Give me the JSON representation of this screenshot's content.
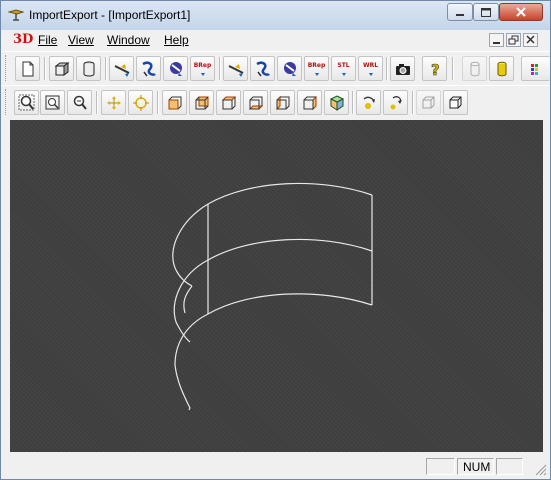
{
  "window": {
    "title": "ImportExport - [ImportExport1]"
  },
  "menubar": {
    "logo": "3D",
    "items": [
      {
        "id": "file",
        "label": "File"
      },
      {
        "id": "view",
        "label": "View"
      },
      {
        "id": "window",
        "label": "Window"
      },
      {
        "id": "help",
        "label": "Help"
      }
    ]
  },
  "toolbar1": {
    "buttons": [
      {
        "name": "new-document-button",
        "icon": "page-icon"
      },
      {
        "name": "open-box-button",
        "icon": "box-icon"
      },
      {
        "name": "open-cylinder-button",
        "icon": "cylinder-icon"
      },
      {
        "name": "import-arrow-button",
        "icon": "arrow-icon"
      },
      {
        "name": "import-iges-button",
        "icon": "iges-icon"
      },
      {
        "name": "import-step-button",
        "icon": "step-icon"
      },
      {
        "name": "import-brep-button",
        "icon": "brep-icon",
        "label": "BRep"
      },
      {
        "name": "export-arrow-button",
        "icon": "arrow-icon"
      },
      {
        "name": "export-iges-button",
        "icon": "iges-icon"
      },
      {
        "name": "export-step-button",
        "icon": "step-icon"
      },
      {
        "name": "export-brep-button",
        "icon": "brep-icon",
        "label": "BRep"
      },
      {
        "name": "export-stl-button",
        "icon": "stl-icon",
        "label": "STL"
      },
      {
        "name": "export-vrml-button",
        "icon": "vrml-icon",
        "label": "WRL"
      },
      {
        "name": "screenshot-button",
        "icon": "camera-icon"
      },
      {
        "name": "help-button",
        "icon": "question-icon"
      },
      {
        "name": "shading-wire-button",
        "icon": "wire-cylinder-icon",
        "disabled": true
      },
      {
        "name": "shading-solid-button",
        "icon": "solid-cylinder-icon"
      },
      {
        "name": "color-button",
        "icon": "color-palette-icon"
      }
    ]
  },
  "toolbar2": {
    "buttons": [
      {
        "name": "zoom-window-button",
        "icon": "zoom-window-icon"
      },
      {
        "name": "fit-all-button",
        "icon": "fit-all-icon"
      },
      {
        "name": "zoom-button",
        "icon": "zoom-icon"
      },
      {
        "name": "pan-button",
        "icon": "pan-icon"
      },
      {
        "name": "global-pan-button",
        "icon": "global-pan-icon"
      },
      {
        "name": "front-view-button",
        "icon": "front-view-icon"
      },
      {
        "name": "back-view-button",
        "icon": "back-view-icon"
      },
      {
        "name": "top-view-button",
        "icon": "top-view-icon"
      },
      {
        "name": "bottom-view-button",
        "icon": "bottom-view-icon"
      },
      {
        "name": "left-view-button",
        "icon": "left-view-icon"
      },
      {
        "name": "right-view-button",
        "icon": "right-view-icon"
      },
      {
        "name": "axo-view-button",
        "icon": "axo-view-icon"
      },
      {
        "name": "rotation-button",
        "icon": "rotation-icon"
      },
      {
        "name": "reset-view-button",
        "icon": "reset-view-icon"
      },
      {
        "name": "hidden-line-off-button",
        "icon": "hlr-off-icon"
      },
      {
        "name": "hidden-line-on-button",
        "icon": "hlr-on-icon"
      }
    ]
  },
  "statusbar": {
    "num": "NUM"
  },
  "colors": {
    "viewport": "#3e3e3e",
    "wire": "#e8e8e8",
    "logo": "#d01010"
  }
}
